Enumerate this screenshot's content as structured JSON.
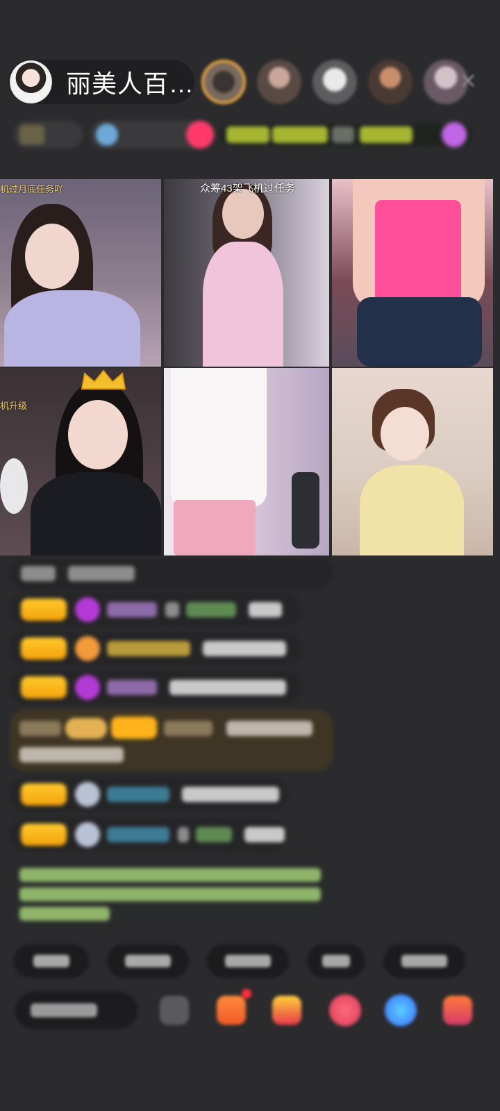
{
  "header": {
    "host_name": "丽美人百…",
    "viewer_count": 5,
    "close_icon": "close-icon"
  },
  "video_grid": {
    "tiles": [
      {
        "caption": "机过月底任务吖",
        "caption_color": "#f6d16a"
      },
      {
        "caption": "众筹43架飞机过任务",
        "caption_color": "#ffffff"
      },
      {
        "caption": "",
        "caption_color": ""
      },
      {
        "caption": "机升级",
        "caption_color": "#f6d16a",
        "badge": "crown-icon"
      },
      {
        "caption": "",
        "caption_color": ""
      },
      {
        "caption": "",
        "caption_color": ""
      }
    ]
  },
  "colors": {
    "background": "#2b2b2d",
    "level_badge": "#ffca2c",
    "fan_purple": "#b43ad6",
    "fan_orange": "#f09a3a",
    "system_text": "#8fb46a",
    "notification": "#ff2d3e"
  },
  "bottom_bar": {
    "icons": [
      "grid-icon",
      "gift-box-icon",
      "treasure-icon",
      "red-pack-icon",
      "blue-chat-icon",
      "more-gift-icon"
    ]
  }
}
